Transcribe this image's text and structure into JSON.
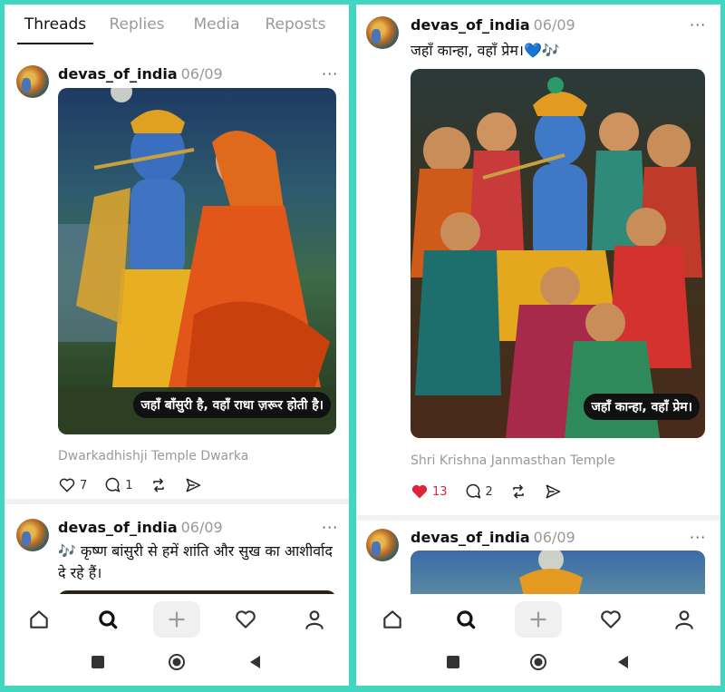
{
  "left": {
    "tabs": [
      "Threads",
      "Replies",
      "Media",
      "Reposts"
    ],
    "post1": {
      "username": "devas_of_india",
      "date": "06/09",
      "caption": "जहाँ बाँसुरी है, वहाँ राधा ज़रूर होती है।",
      "location": "Dwarkadhishji Temple Dwarka",
      "likes": "7",
      "replies": "1"
    },
    "post2": {
      "username": "devas_of_india",
      "date": "06/09",
      "text": "🎶 कृष्ण बांसुरी से हमें शांति और सुख का आशीर्वाद दे रहे हैं।"
    }
  },
  "right": {
    "post1": {
      "username": "devas_of_india",
      "date": "06/09",
      "text": "जहाँ कान्हा, वहाँ प्रेम।💙🎶",
      "caption": "जहाँ कान्हा, वहाँ प्रेम।",
      "location": "Shri Krishna Janmasthan Temple",
      "likes": "13",
      "replies": "2"
    },
    "post2": {
      "username": "devas_of_india",
      "date": "06/09"
    }
  },
  "more_glyph": "···",
  "colors": {
    "border": "#40d6c0",
    "like_active": "#e0223a"
  },
  "icons": [
    "home-icon",
    "search-icon",
    "plus-icon",
    "heart-icon",
    "profile-icon",
    "square-icon",
    "circle-icon",
    "back-triangle-icon",
    "reply-icon",
    "repost-icon",
    "share-icon"
  ]
}
